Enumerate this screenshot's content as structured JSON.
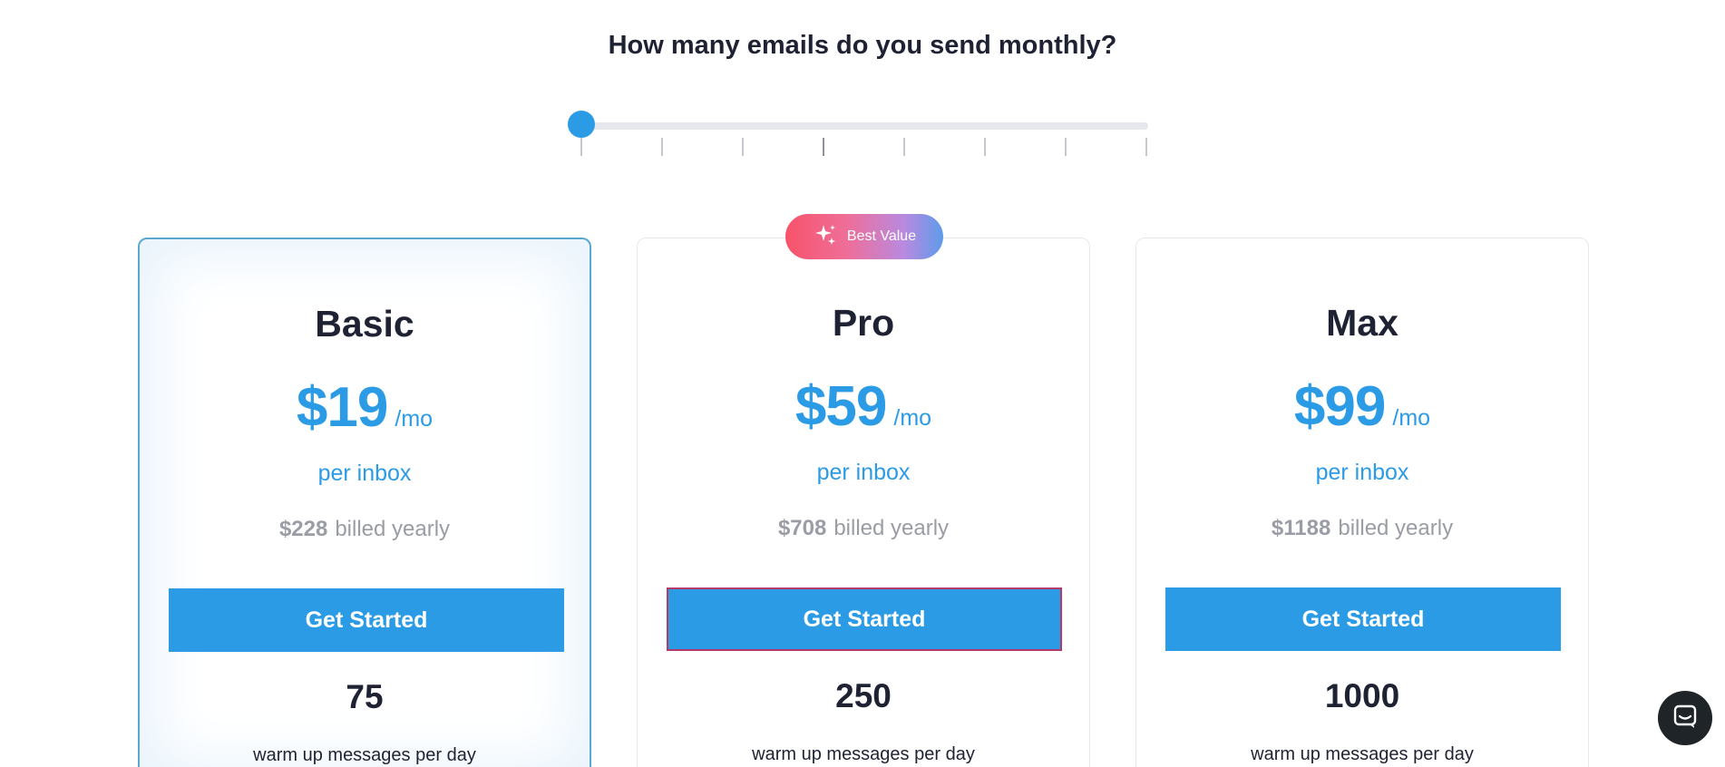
{
  "question": "How many emails do you send monthly?",
  "slider": {
    "tick_count": 8,
    "selected_index": 0,
    "accent": "#2b9be6"
  },
  "badge": {
    "label": "Best Value",
    "icon": "sparkle-icon"
  },
  "plans": [
    {
      "name": "Basic",
      "price": "$19",
      "period": "/mo",
      "unit": "per inbox",
      "yearly_amount": "$228",
      "yearly_label": "billed yearly",
      "cta": "Get Started",
      "count": "75",
      "count_label": "warm up messages per day"
    },
    {
      "name": "Pro",
      "price": "$59",
      "period": "/mo",
      "unit": "per inbox",
      "yearly_amount": "$708",
      "yearly_label": "billed yearly",
      "cta": "Get Started",
      "count": "250",
      "count_label": "warm up messages per day"
    },
    {
      "name": "Max",
      "price": "$99",
      "period": "/mo",
      "unit": "per inbox",
      "yearly_amount": "$1188",
      "yearly_label": "billed yearly",
      "cta": "Get Started",
      "count": "1000",
      "count_label": "warm up messages per day"
    }
  ],
  "chat": {
    "icon": "chat-icon"
  },
  "colors": {
    "accent": "#2b9be6",
    "text": "#1f2233",
    "muted": "#9a9ca6"
  }
}
